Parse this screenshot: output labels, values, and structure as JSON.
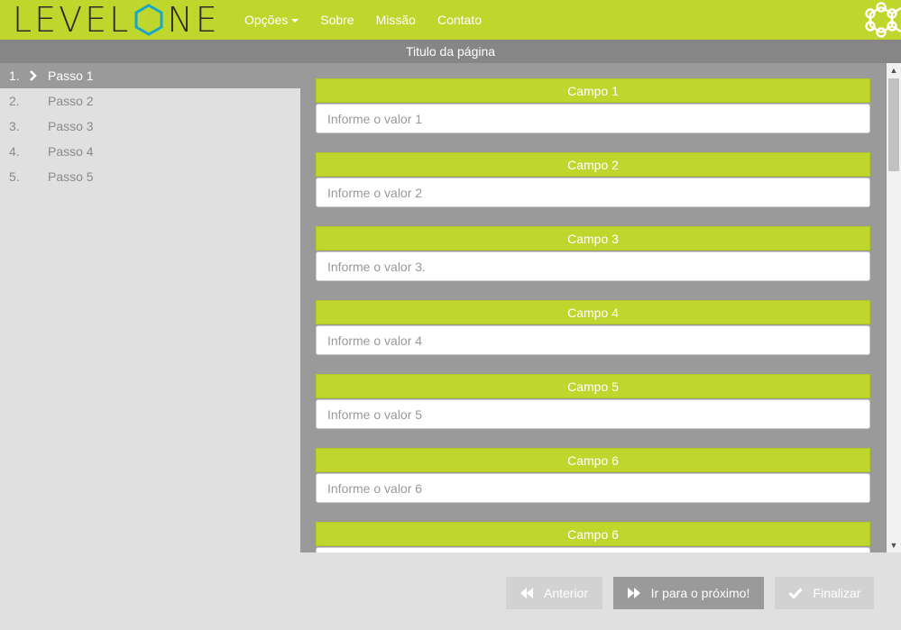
{
  "brand": {
    "logo_left": "LEVEL",
    "logo_right": "NE",
    "accent_color": "#bfd62c",
    "hex_color": "#1aa7c7"
  },
  "nav": {
    "items": [
      {
        "label": "Opções",
        "has_dropdown": true
      },
      {
        "label": "Sobre"
      },
      {
        "label": "Missão"
      },
      {
        "label": "Contato"
      }
    ],
    "right_icon": "molecule-icon"
  },
  "page": {
    "title": "Titulo da página"
  },
  "steps": [
    {
      "number": "1.",
      "label": "Passo 1",
      "active": true
    },
    {
      "number": "2.",
      "label": "Passo 2"
    },
    {
      "number": "3.",
      "label": "Passo 3"
    },
    {
      "number": "4.",
      "label": "Passo 4"
    },
    {
      "number": "5.",
      "label": "Passo 5"
    }
  ],
  "fields": [
    {
      "title": "Campo 1",
      "placeholder": "Informe o valor 1"
    },
    {
      "title": "Campo 2",
      "placeholder": "Informe o valor 2"
    },
    {
      "title": "Campo 3",
      "placeholder": "Informe o valor 3."
    },
    {
      "title": "Campo 4",
      "placeholder": "Informe o valor 4"
    },
    {
      "title": "Campo 5",
      "placeholder": "Informe o valor 5"
    },
    {
      "title": "Campo 6",
      "placeholder": "Informe o valor 6"
    },
    {
      "title": "Campo 6",
      "placeholder": ""
    }
  ],
  "footer": {
    "prev_label": "Anterior",
    "next_label": "Ir para o próximo!",
    "finish_label": "Finalizar"
  }
}
